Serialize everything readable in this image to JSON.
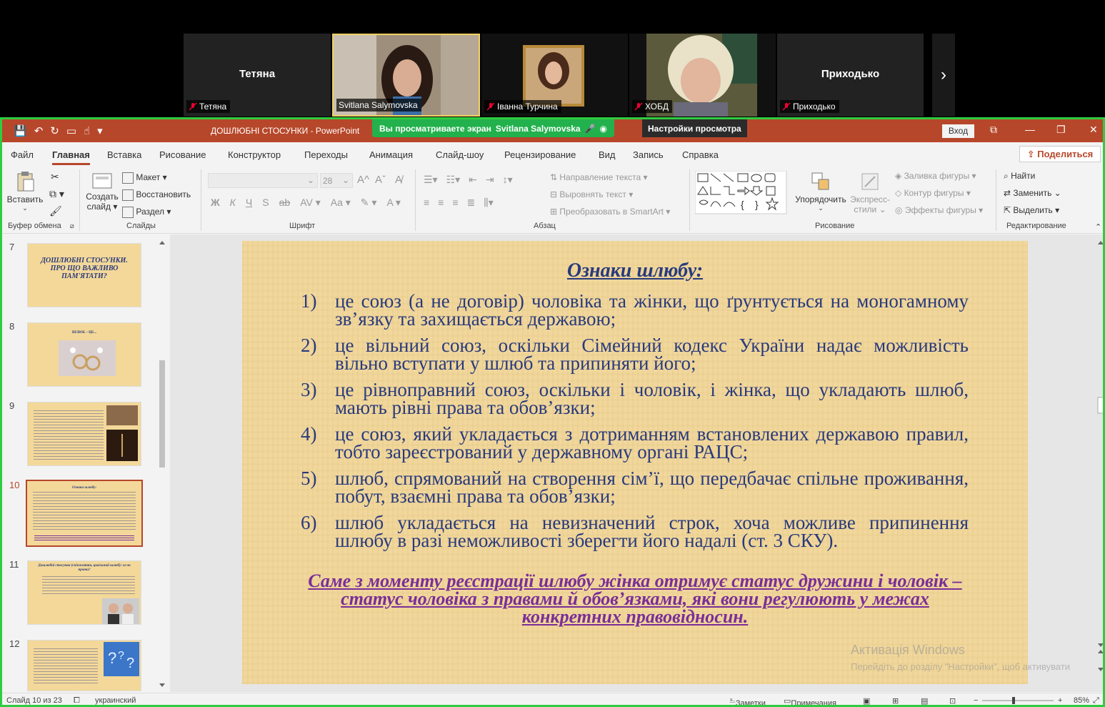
{
  "participants": [
    {
      "name": "Тетяна",
      "label": "Тетяна",
      "video": false
    },
    {
      "name": "Svitlana Salymovska",
      "label": "Svitlana Salymovska",
      "video": true,
      "speaking": true
    },
    {
      "name": "Іванна Турчина",
      "label": "Іванна Турчина",
      "video": true
    },
    {
      "name": "ХОБД",
      "label": "ХОБД",
      "video": true
    },
    {
      "name": "Приходько",
      "label": "Приходько",
      "video": false
    }
  ],
  "share_banner": {
    "text": "Вы просматриваете экран",
    "presenter": "Svitlana Salymovska",
    "view_options": "Настройки просмотра"
  },
  "window": {
    "doc_title": "ДОШЛЮБНІ СТОСУНКИ  -  PowerPoint",
    "signin_label": "Вход"
  },
  "menu": {
    "tabs": [
      "Файл",
      "Главная",
      "Вставка",
      "Рисование",
      "Конструктор",
      "Переходы",
      "Анимация",
      "Слайд-шоу",
      "Рецензирование",
      "Вид",
      "Запись",
      "Справка"
    ],
    "active": "Главная",
    "share_label": "Поделиться"
  },
  "ribbon": {
    "clipboard": {
      "paste": "Вставить",
      "group": "Буфер обмена"
    },
    "slides": {
      "new_slide_1": "Создать",
      "new_slide_2": "слайд",
      "layout": "Макет",
      "reset": "Восстановить",
      "section": "Раздел",
      "group": "Слайды"
    },
    "font": {
      "font_name": "",
      "font_size": "28",
      "group": "Шрифт"
    },
    "paragraph": {
      "text_direction": "Направление текста",
      "align_text": "Выровнять текст",
      "smartart": "Преобразовать в SmartArt",
      "group": "Абзац"
    },
    "drawing": {
      "arrange": "Упорядочить",
      "quick_styles_1": "Экспресс-",
      "quick_styles_2": "стили",
      "shape_fill": "Заливка фигуры",
      "shape_outline": "Контур фигуры",
      "shape_effects": "Эффекты фигуры",
      "group": "Рисование"
    },
    "editing": {
      "find": "Найти",
      "replace": "Заменить",
      "select": "Выделить",
      "group": "Редактирование"
    }
  },
  "thumbnails": [
    {
      "num": "7",
      "title": "ДОШЛЮБНІ СТОСУНКИ. ПРО ЩО ВАЖЛИВО ПАМ'ЯТАТИ?"
    },
    {
      "num": "8",
      "title": "ШЛЮБ – ЦЕ..."
    },
    {
      "num": "9",
      "title": ""
    },
    {
      "num": "10",
      "title": "Ознаки шлюбу:"
    },
    {
      "num": "11",
      "title": "Дошлюбні стосунки (співжиття, цивільний шлюб): за чи проти?"
    },
    {
      "num": "12",
      "title": ""
    }
  ],
  "slide": {
    "title": "Ознаки шлюбу:",
    "items": [
      {
        "num": "1)",
        "text": "це союз (а не договір) чоловіка та жінки, що ґрунтується на моногамному зв’язку та захищається державою;"
      },
      {
        "num": "2)",
        "text": "це вільний союз, оскільки Сімейний кодекс України надає можливість вільно вступати у шлюб та припиняти його;"
      },
      {
        "num": "3)",
        "text": "це рівноправний союз, оскільки і чоловік, і жінка, що укладають шлюб, мають рівні права та обов’язки;"
      },
      {
        "num": "4)",
        "text": "це союз, який укладається з дотриманням встановлених державою правил, тобто зареєстрований у державному органі РАЦС;"
      },
      {
        "num": "5)",
        "text": "шлюб, спрямований на створення сім’ї, що передбачає спільне проживання, побут, взаємні права та обов’язки;"
      },
      {
        "num": "6)",
        "text": "шлюб укладається на невизначений строк, хоча можливе припинення шлюбу в разі неможливості зберегти його надалі (ст. 3 СКУ)."
      }
    ],
    "footer": "Саме з моменту реєстрації шлюбу жінка отримує статус дружини і чоловік – статус чоловіка з правами й обов’язками, які вони регулюють у межах конкретних правовідносин."
  },
  "watermark": {
    "line1": "Активація Windows",
    "line2": "Перейдіть до розділу \"Настройки\", щоб активувати"
  },
  "status": {
    "slide_info": "Слайд 10 из 23",
    "language": "украинский",
    "notes": "Заметки",
    "comments": "Примечания",
    "zoom": "85%"
  },
  "colors": {
    "powerpoint_red": "#b7472a",
    "share_green": "#22b14c",
    "slide_text": "#283a7d",
    "slide_footer": "#7a2e98",
    "slide_bg": "#f1d79b"
  }
}
